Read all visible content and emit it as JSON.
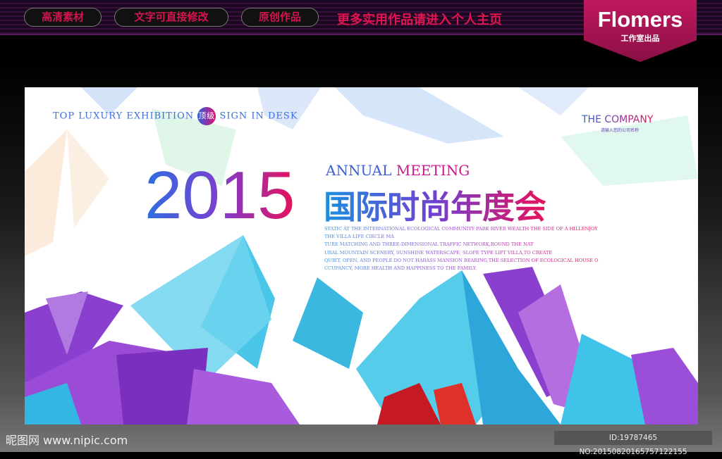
{
  "header": {
    "tags": [
      "高清素材",
      "文字可直接修改",
      "原创作品"
    ],
    "promo": "更多实用作品请进入个人主页",
    "brand": {
      "name": "Flomers",
      "sub": "工作室出品"
    }
  },
  "poster": {
    "top_line": {
      "left": "TOP LUXURY EXHIBITION",
      "badge": "顶级",
      "right": "SIGN IN DESK"
    },
    "year": "2015",
    "annual": "ANNUAL",
    "meeting": "MEETING",
    "title_cn": "国际时尚年度会",
    "paragraph": "STATIC AT THE INTERNATIONAL ECOLOGICAL COMMUNITY PARK RIVER WEALTH THE SIDE OF A HILLENJOY\nTHE VILLA LIFE CIRCLE MA\nTURE MATCHING AND THREE-DIMENSIONAL TRAFFIC NETWORK,ROUND THE NAT\nURAL MOUNTAIN SCENERY, SUNSHINE WATERSCAPE, SLOPE TYPE LIFT VILLA,TO CREATE\nQUIET, OPEN, AND PEOPLE DO NOT HARASS MANSION BEARING,THE SELECTION OF ECOLOGICAL HOUSE O\nCCUPANCY, MORE HEALTH AND HAPPINESS TO THE FAMILY.",
    "company": "THE COMPANY",
    "company_sub": "请输入您的公司名称"
  },
  "footer": {
    "watermark": "昵图网 www.nipic.com",
    "id": "ID:19787465 NO:20150820165757122155"
  },
  "colors": {
    "accent_pink": "#e0144f",
    "blue": "#2d6ee0",
    "purple": "#8a3fd0",
    "cyan": "#3cc4e8"
  }
}
